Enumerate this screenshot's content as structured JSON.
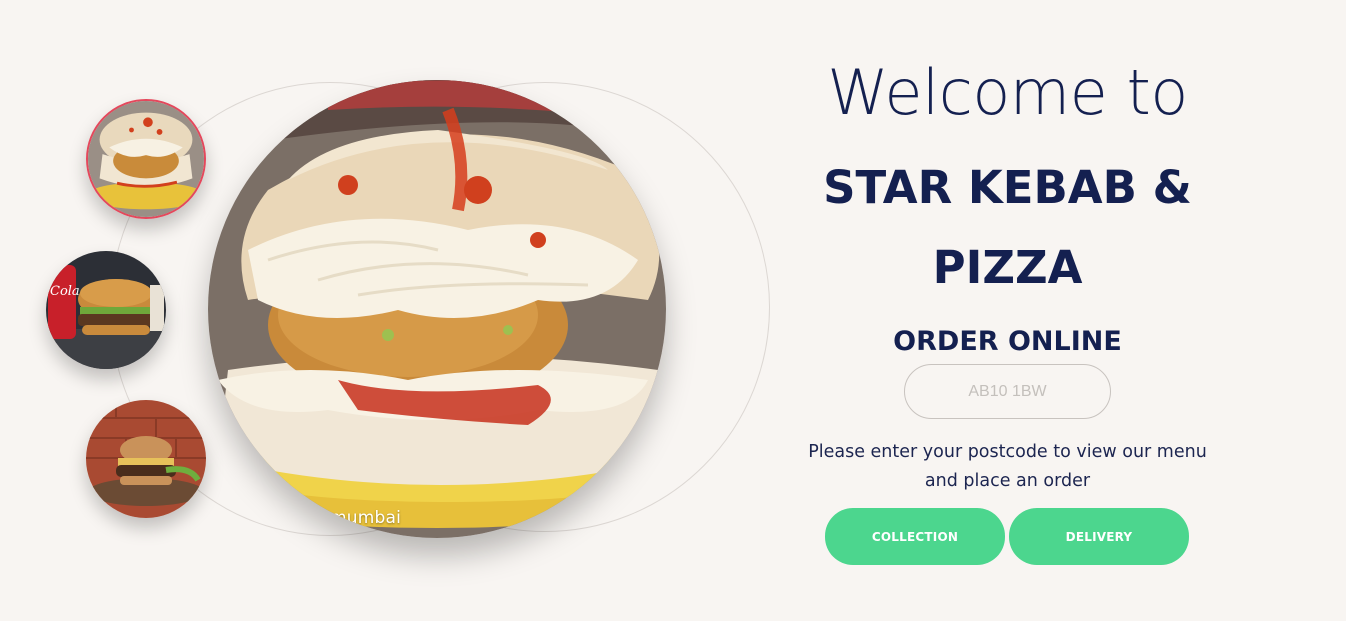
{
  "hero": {
    "caption": "mumbai"
  },
  "thumbnails": [
    {
      "name": "vada-pav",
      "selected": true
    },
    {
      "name": "burger-with-cola",
      "selected": false
    },
    {
      "name": "burger-on-board",
      "selected": false
    }
  ],
  "welcome": {
    "heading": "Welcome to",
    "brand_line1": "STAR KEBAB &",
    "brand_line2": "PIZZA"
  },
  "order": {
    "title": "ORDER ONLINE",
    "postcode_placeholder": "AB10 1BW",
    "postcode_value": "",
    "hint": "Please enter your postcode to view our menu and place an order",
    "collection_label": "COLLECTION",
    "delivery_label": "DELIVERY"
  },
  "colors": {
    "background": "#f8f5f2",
    "heading": "#142050",
    "button": "#4cd68e",
    "selected_border": "#e4485c"
  }
}
